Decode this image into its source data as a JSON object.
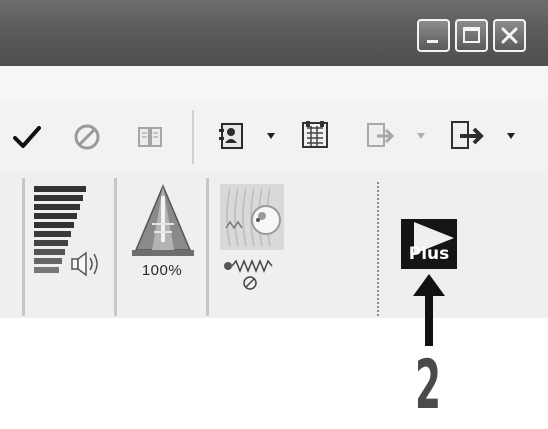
{
  "window": {
    "minimize_label": "_",
    "maximize_label": "□",
    "close_label": "×"
  },
  "toolbar": {
    "items": [
      {
        "name": "check-icon",
        "state": "enabled"
      },
      {
        "name": "cancel-icon",
        "state": "disabled"
      },
      {
        "name": "book-icon",
        "state": "disabled"
      },
      {
        "name": "contacts-icon",
        "state": "enabled",
        "dropdown": true
      },
      {
        "name": "calendar-icon",
        "state": "enabled"
      },
      {
        "name": "transfer-icon",
        "state": "disabled",
        "dropdown": true
      },
      {
        "name": "export-icon",
        "state": "enabled",
        "dropdown": true
      }
    ]
  },
  "controls": {
    "volume": {
      "icon": "volume-bars-icon"
    },
    "speed": {
      "label": "100%",
      "icon": "metronome-icon"
    },
    "noise": {
      "icon": "noise-cancel-icon"
    },
    "plus_button": {
      "label": "Plus",
      "icon": "play-plus-icon"
    }
  },
  "callout": {
    "number": "2"
  },
  "colors": {
    "titlebar": "#5b5b5b",
    "plus_button_bg": "#151515",
    "callout": "#111111"
  }
}
